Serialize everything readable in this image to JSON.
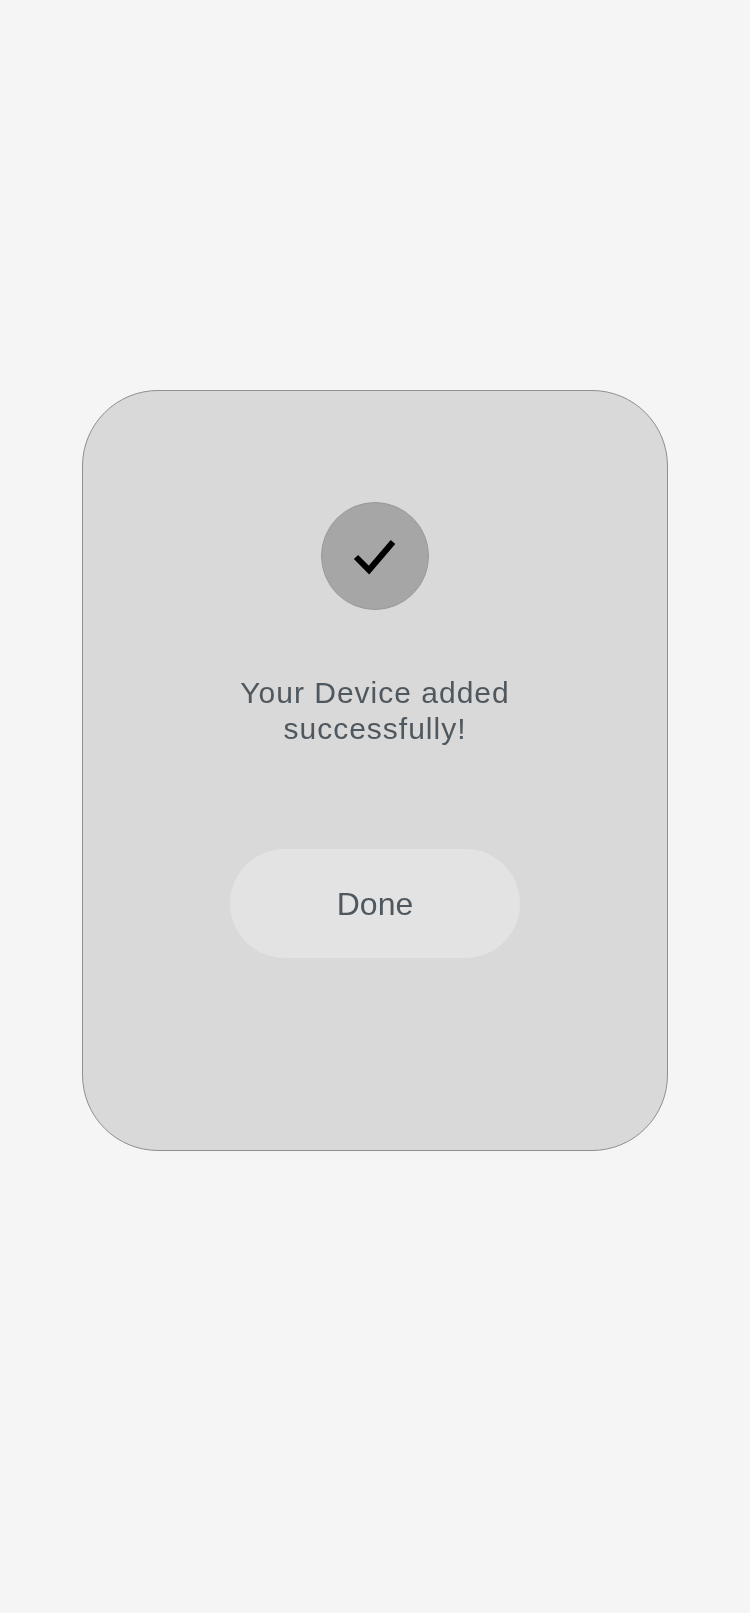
{
  "dialog": {
    "message": "Your Device added successfully!",
    "button": "Done"
  }
}
